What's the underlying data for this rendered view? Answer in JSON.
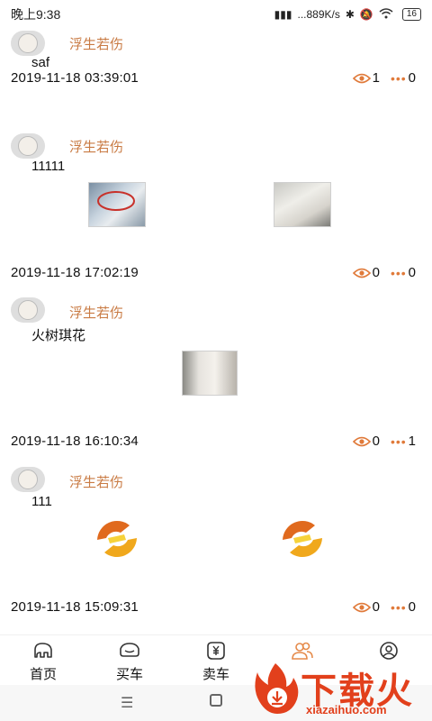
{
  "status_bar": {
    "time": "晚上9:38",
    "network_speed": "...889K/s",
    "battery": "16"
  },
  "posts": [
    {
      "username": "浮生若伤",
      "content": "saf",
      "datetime": "2019-11-18 03:39:01",
      "views": "1",
      "comments": "0",
      "images": []
    },
    {
      "username": "浮生若伤",
      "content": "11111",
      "datetime": "2019-11-18 17:02:19",
      "views": "0",
      "comments": "0",
      "images": [
        "photo-document",
        "photo-screen"
      ]
    },
    {
      "username": "浮生若伤",
      "content": "火树琪花",
      "datetime": "2019-11-18 16:10:34",
      "views": "0",
      "comments": "1",
      "images": [
        "photo-certificate"
      ]
    },
    {
      "username": "浮生若伤",
      "content": "111",
      "datetime": "2019-11-18 15:09:31",
      "views": "0",
      "comments": "0",
      "images": [
        "logo-swirl",
        "logo-swirl"
      ]
    }
  ],
  "tabbar": {
    "items": [
      {
        "label": "首页",
        "icon": "elephant-icon"
      },
      {
        "label": "买车",
        "icon": "car-icon"
      },
      {
        "label": "卖车",
        "icon": "yen-tag-icon"
      },
      {
        "label": "",
        "icon": "people-icon",
        "active": true
      },
      {
        "label": "",
        "icon": "profile-icon"
      }
    ]
  },
  "watermark": {
    "text": "下载火",
    "url": "xiazaihuo.com"
  },
  "colors": {
    "accent": "#e58a4a",
    "username": "#c97b44",
    "watermark": "#e2401c"
  }
}
